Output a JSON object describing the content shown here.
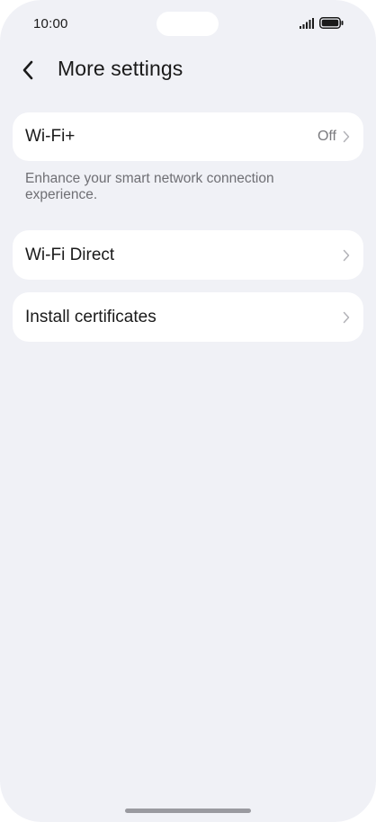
{
  "status_bar": {
    "time": "10:00",
    "signal_icon": "signal-bars-icon",
    "battery_icon": "battery-full-icon"
  },
  "header": {
    "title": "More settings",
    "back_icon": "chevron-left-icon"
  },
  "settings": {
    "wifi_plus": {
      "label": "Wi-Fi+",
      "value": "Off",
      "description": "Enhance your smart network connection experience."
    },
    "wifi_direct": {
      "label": "Wi-Fi Direct"
    },
    "install_certificates": {
      "label": "Install certificates"
    }
  },
  "colors": {
    "background": "#f0f1f6",
    "card": "#ffffff",
    "text_primary": "#1a1a1a",
    "text_secondary": "#6f6f74"
  }
}
